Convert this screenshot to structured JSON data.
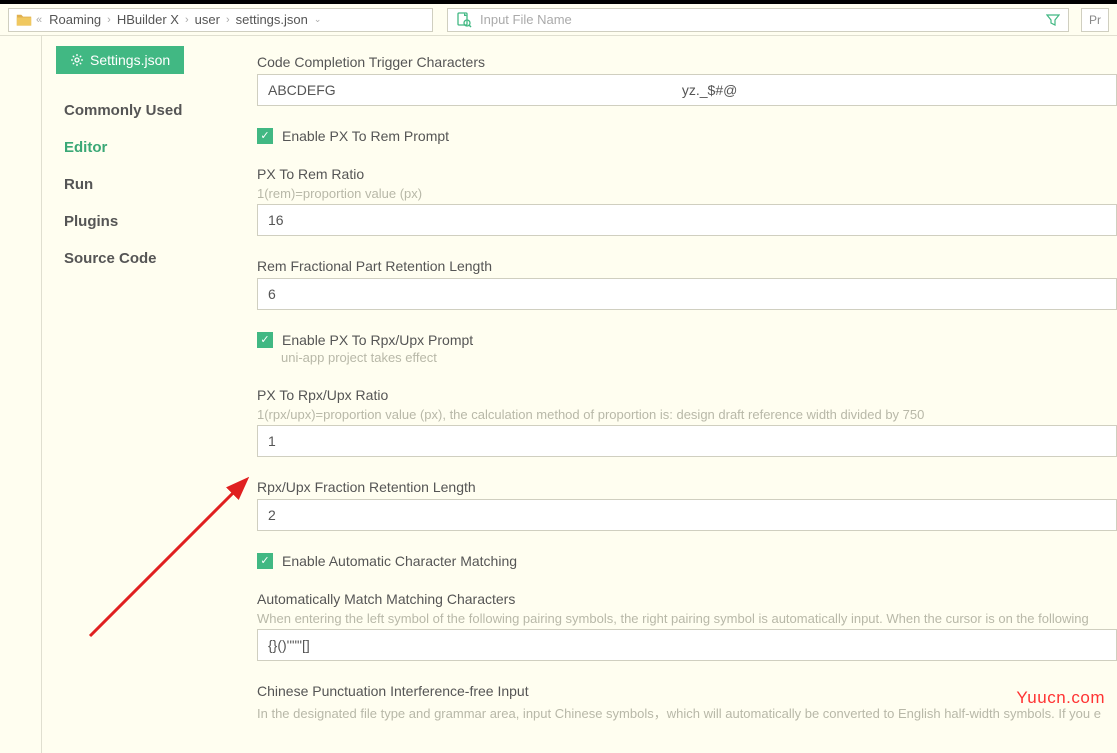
{
  "breadcrumb": {
    "items": [
      "Roaming",
      "HBuilder X",
      "user",
      "settings.json"
    ]
  },
  "search": {
    "placeholder": "Input File Name",
    "rightLabel": "Pr"
  },
  "tab": {
    "label": "Settings.json"
  },
  "sidebar": {
    "items": [
      {
        "label": "Commonly Used"
      },
      {
        "label": "Editor"
      },
      {
        "label": "Run"
      },
      {
        "label": "Plugins"
      },
      {
        "label": "Source Code"
      }
    ],
    "activeIndex": 1
  },
  "settings": {
    "codeCompletion": {
      "label": "Code Completion Trigger Characters",
      "value": "ABCDEFG                                                                                         yz._$#@"
    },
    "enablePxRem": {
      "label": "Enable PX To Rem Prompt",
      "checked": true
    },
    "pxRemRatio": {
      "label": "PX To Rem Ratio",
      "hint": "1(rem)=proportion value (px)",
      "value": "16"
    },
    "remFractional": {
      "label": "Rem Fractional Part Retention Length",
      "value": "6"
    },
    "enablePxRpx": {
      "label": "Enable PX To Rpx/Upx Prompt",
      "sublabel": "uni-app project takes effect",
      "checked": true
    },
    "pxRpxRatio": {
      "label": "PX To Rpx/Upx Ratio",
      "hint": "1(rpx/upx)=proportion value (px), the calculation method of proportion is: design draft reference width divided by 750",
      "value": "1"
    },
    "rpxFraction": {
      "label": "Rpx/Upx Fraction Retention Length",
      "value": "2"
    },
    "autoCharMatch": {
      "label": "Enable Automatic Character Matching",
      "checked": true
    },
    "matchingChars": {
      "label": "Automatically Match Matching Characters",
      "hint": "When entering the left symbol of the following pairing symbols, the right pairing symbol is automatically input. When the cursor is on the following",
      "value": "{}()''\"\"[]"
    },
    "chinesePunctuation": {
      "label": "Chinese Punctuation Interference-free Input",
      "hint": "In the designated file type and grammar area, input Chinese symbols，which will automatically be converted to English half-width symbols. If you e"
    }
  },
  "watermark": "Yuucn.com"
}
